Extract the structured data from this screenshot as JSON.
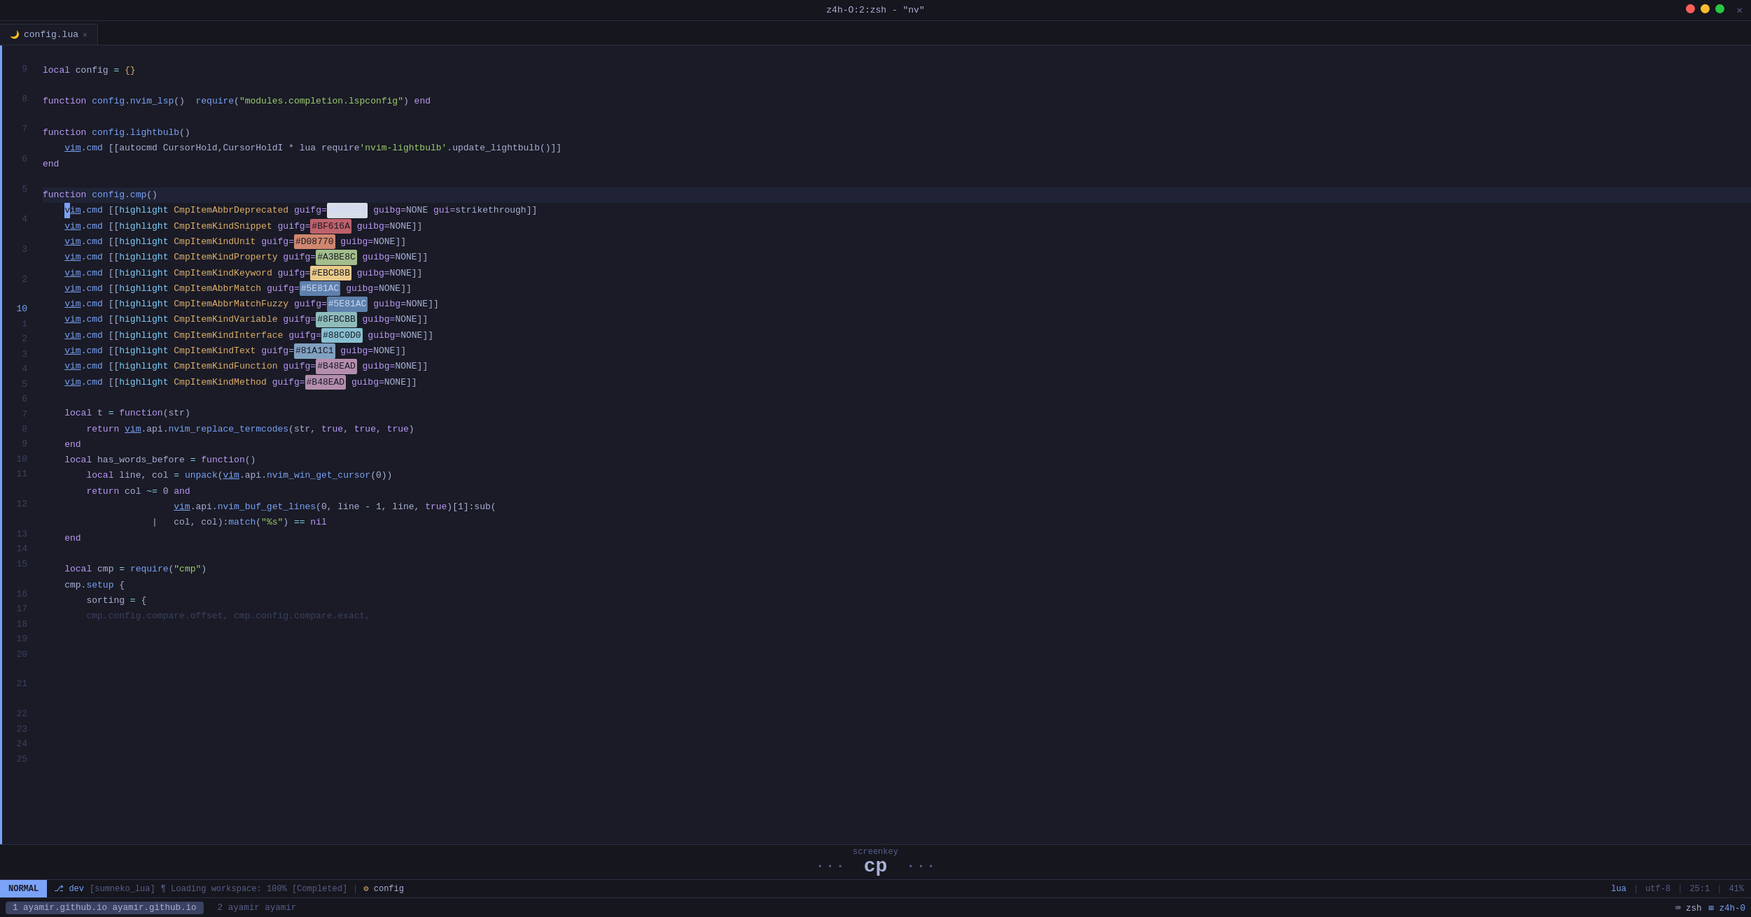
{
  "titleBar": {
    "title": "z4h-O:2:zsh - \"nv\"",
    "dots": [
      "dot-red",
      "dot-yellow",
      "dot-green"
    ]
  },
  "tabs": [
    {
      "icon": "lua",
      "label": "config.lua",
      "active": true
    }
  ],
  "lineNumbers": [
    8,
    7,
    6,
    5,
    4,
    3,
    2,
    10,
    1,
    2,
    3,
    4,
    5,
    6,
    7,
    8,
    9,
    10,
    11,
    12,
    13,
    14,
    15,
    16,
    17,
    18,
    19,
    20,
    21,
    22,
    23,
    24,
    25
  ],
  "codeLines": [
    "",
    "local config = {}",
    "",
    "function config.nvim_lsp()  require(\"modules.completion.lspconfig\") end",
    "",
    "function config.lightbulb()",
    "    vim.cmd [[autocmd CursorHold,CursorHoldI * lua require'nvim-lightbulb'.update_lightbulb()]]",
    "end",
    "",
    "function config.cmp()",
    "    vim.cmd [[highlight CmpItemAbbrDeprecated guifg=#D8DEE9 guibg=NONE gui=strikethrough]]",
    "    vim.cmd [[highlight CmpItemKindSnippet guifg=#BF616A guibg=NONE]]",
    "    vim.cmd [[highlight CmpItemKindUnit guifg=#D08770 guibg=NONE]]",
    "    vim.cmd [[highlight CmpItemKindProperty guifg=#A3BE8C guibg=NONE]]",
    "    vim.cmd [[highlight CmpItemKindKeyword guifg=#EBCB8B guibg=NONE]]",
    "    vim.cmd [[highlight CmpItemAbbrMatch guifg=#5E81AC guibg=NONE]]",
    "    vim.cmd [[highlight CmpItemAbbrMatchFuzzy guifg=#5E81AC guibg=NONE]]",
    "    vim.cmd [[highlight CmpItemKindVariable guifg=#8FBCBB guibg=NONE]]",
    "    vim.cmd [[highlight CmpItemKindInterface guifg=#88C0D0 guibg=NONE]]",
    "    vim.cmd [[highlight CmpItemKindText guifg=#81A1C1 guibg=NONE]]",
    "    vim.cmd [[highlight CmpItemKindFunction guifg=#B48EAD guibg=NONE]]",
    "    vim.cmd [[highlight CmpItemKindMethod guifg=#B48EAD guibg=NONE]]",
    "",
    "    local t = function(str)",
    "        return vim.api.nvim_replace_termcodes(str, true, true, true)",
    "    end",
    "    local has_words_before = function()",
    "        local line, col = unpack(vim.api.nvim_win_get_cursor(0))",
    "        return col ~= 0 and",
    "                        vim.api.nvim_buf_get_lines(0, line - 1, line, true)[1]:sub(",
    "                    |   col, col):match(\"%s\") == nil",
    "    end",
    "",
    "    local cmp = require(\"cmp\")",
    "    cmp.setup {",
    "        sorting = {"
  ],
  "ghostLine": "        cmp.config.compare.offset, cmp.config.compare.exact,",
  "statusBar": {
    "mode": "NORMAL",
    "branch": " dev",
    "lsp": "[sumneko_lua]",
    "loading": "Loading workspace: 100% [Completed]",
    "filename": "config",
    "filetype": "lua",
    "encoding": "utf-8",
    "lineInfo": "25:1",
    "scrollPct": "41%"
  },
  "screenkey": {
    "label": "screenkey",
    "key": "cp"
  },
  "bottomBar": {
    "tab1": "1",
    "tab1label": "ayamir.github.io",
    "tab2": "2",
    "tab2label": "ayamir",
    "rightItems": [
      "zsh",
      "z4h-0"
    ]
  }
}
